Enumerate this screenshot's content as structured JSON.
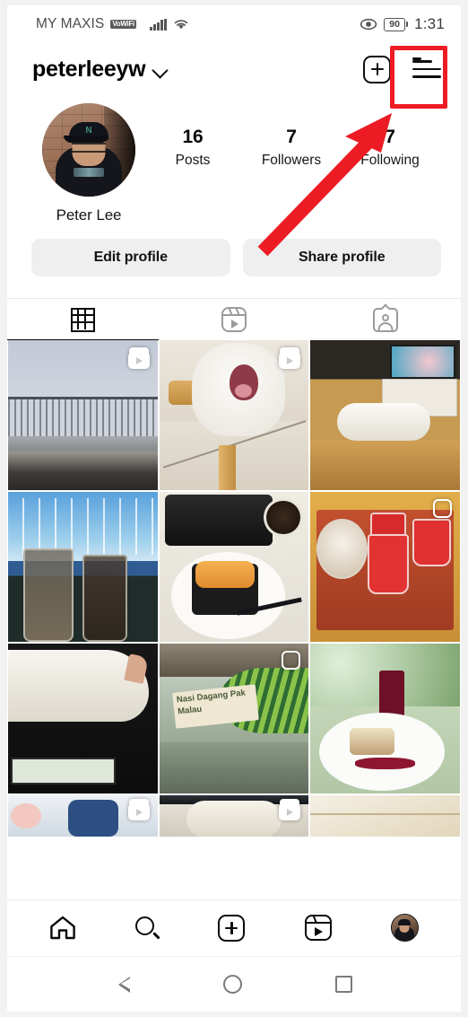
{
  "status_bar": {
    "carrier": "MY MAXIS",
    "network_badge": "VoWiFi",
    "signal_icon": "signal-bars-icon",
    "wifi_icon": "wifi-icon",
    "eye_icon": "eye-icon",
    "battery_level": "90",
    "time": "1:31"
  },
  "header": {
    "username": "peterleeyw",
    "chevron_icon": "chevron-down-icon",
    "create_icon": "plus-square-icon",
    "menu_icon": "hamburger-menu-icon",
    "menu_has_notification": true,
    "notification_color": "#ff2d2d"
  },
  "profile": {
    "avatar_icon": "profile-avatar",
    "display_name": "Peter Lee",
    "stats": [
      {
        "count": "16",
        "label": "Posts"
      },
      {
        "count": "7",
        "label": "Followers"
      },
      {
        "count": "7",
        "label": "Following"
      }
    ]
  },
  "actions": {
    "edit_profile": "Edit profile",
    "share_profile": "Share profile"
  },
  "tabs": [
    {
      "name": "grid",
      "icon": "grid-icon",
      "active": true
    },
    {
      "name": "reels",
      "icon": "reels-icon",
      "active": false
    },
    {
      "name": "tagged",
      "icon": "tagged-person-icon",
      "active": false
    }
  ],
  "grid_posts": [
    {
      "id": "p1",
      "desc": "balcony-railing-cloudy-sky",
      "badge": "reel"
    },
    {
      "id": "p2",
      "desc": "white-cat-yawning-on-stool",
      "badge": "reel"
    },
    {
      "id": "p3",
      "desc": "white-cat-lying-on-table-near-tv",
      "badge": "none"
    },
    {
      "id": "p4",
      "desc": "iced-drinks-at-marina",
      "badge": "none"
    },
    {
      "id": "p5",
      "desc": "uni-sushi-gunkan-on-plate",
      "badge": "none"
    },
    {
      "id": "p6",
      "desc": "red-drinks-on-wooden-tray",
      "badge": "carousel"
    },
    {
      "id": "p7",
      "desc": "cat-sleeping-on-laptop",
      "badge": "none"
    },
    {
      "id": "p8",
      "desc": "nasi-dagang-pak-malau-restaurant",
      "badge": "carousel",
      "sign_text": "Nasi Dagang\nPak Malau"
    },
    {
      "id": "p9",
      "desc": "dessert-on-white-plate-outdoors",
      "badge": "none"
    },
    {
      "id": "p10",
      "desc": "person-behind-glass",
      "badge": "reel"
    },
    {
      "id": "p11",
      "desc": "cat-sleeping-closeup",
      "badge": "reel"
    },
    {
      "id": "p12",
      "desc": "light-beige-wall",
      "badge": "none"
    }
  ],
  "bottom_nav": [
    {
      "name": "home",
      "icon": "home-icon"
    },
    {
      "name": "search",
      "icon": "search-icon"
    },
    {
      "name": "create",
      "icon": "plus-square-icon"
    },
    {
      "name": "reels",
      "icon": "reels-icon"
    },
    {
      "name": "profile",
      "icon": "profile-avatar-icon"
    }
  ],
  "android_nav": [
    {
      "name": "back",
      "icon": "triangle-back-icon"
    },
    {
      "name": "home",
      "icon": "circle-home-icon"
    },
    {
      "name": "recents",
      "icon": "square-recents-icon"
    }
  ],
  "annotation": {
    "highlight_color": "#ed1c24",
    "target": "hamburger-menu-icon"
  }
}
